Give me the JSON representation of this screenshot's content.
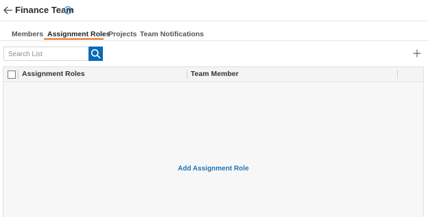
{
  "header": {
    "title": "Finance Team",
    "back_icon": "arrow-left-icon",
    "help_icon": "question-circle-icon"
  },
  "tabs": [
    {
      "label": "Members",
      "active": false
    },
    {
      "label": "Assignment Roles",
      "active": true
    },
    {
      "label": "Projects",
      "active": false
    },
    {
      "label": "Team Notifications",
      "active": false
    }
  ],
  "toolbar": {
    "search_placeholder": "Search List",
    "search_icon": "search-icon",
    "add_icon": "plus-icon"
  },
  "grid": {
    "columns": [
      "Assignment Roles",
      "Team Member"
    ],
    "empty_action": "Add Assignment Role"
  },
  "colors": {
    "accent": "#e8701a",
    "primary": "#0a6bb5",
    "link": "#1d73b8"
  }
}
